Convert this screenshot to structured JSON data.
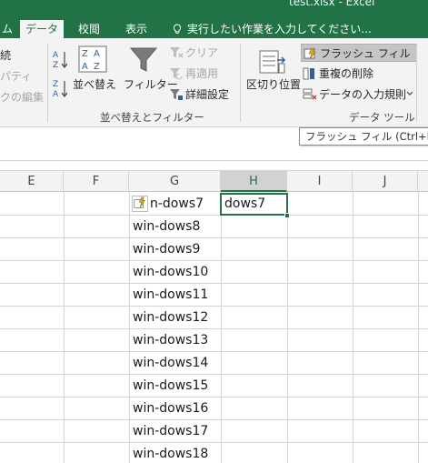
{
  "window": {
    "title": "test.xlsx - Excel"
  },
  "tabs": [
    {
      "label": "データ",
      "active": true
    },
    {
      "label": "校閲",
      "active": false
    },
    {
      "label": "表示",
      "active": false
    }
  ],
  "tab_cut": "ム",
  "tell_me": "実行したい作業を入力してください...",
  "ribbon": {
    "left_cut": {
      "item1": "続",
      "item2": "パティ",
      "item3": "クの編集"
    },
    "sort": {
      "sort_button": "並べ替え",
      "filter_button": "フィルター",
      "clear": "クリア",
      "reapply": "再適用",
      "advanced": "詳細設定",
      "group_label": "並べ替えとフィルター"
    },
    "data_tools": {
      "text_to_columns": "区切り位置",
      "flash_fill": "フラッシュ フィル",
      "remove_duplicates": "重複の削除",
      "data_validation": "データの入力規則",
      "group_label": "データ ツール"
    }
  },
  "tooltip": "フラッシュ フィル (Ctrl+E)",
  "columns": [
    "E",
    "F",
    "G",
    "H",
    "I",
    "J"
  ],
  "selected_column": "H",
  "cells": {
    "G": [
      "n-dows7",
      "win-dows8",
      "win-dows9",
      "win-dows10",
      "win-dows11",
      "win-dows12",
      "win-dows13",
      "win-dows14",
      "win-dows15",
      "win-dows16",
      "win-dows17",
      "win-dows18"
    ],
    "H1": "dows7"
  },
  "colors": {
    "accent": "#217346",
    "ribbon_bg": "#f3f3f3",
    "grid_line": "#d4d4d4"
  },
  "icons": [
    "sort-az-icon",
    "sort-za-icon",
    "sort-dialog-icon",
    "filter-icon",
    "clear-filter-icon",
    "reapply-icon",
    "advanced-filter-icon",
    "text-to-columns-icon",
    "flash-fill-icon",
    "remove-duplicates-icon",
    "data-validation-icon",
    "lightbulb-icon"
  ]
}
